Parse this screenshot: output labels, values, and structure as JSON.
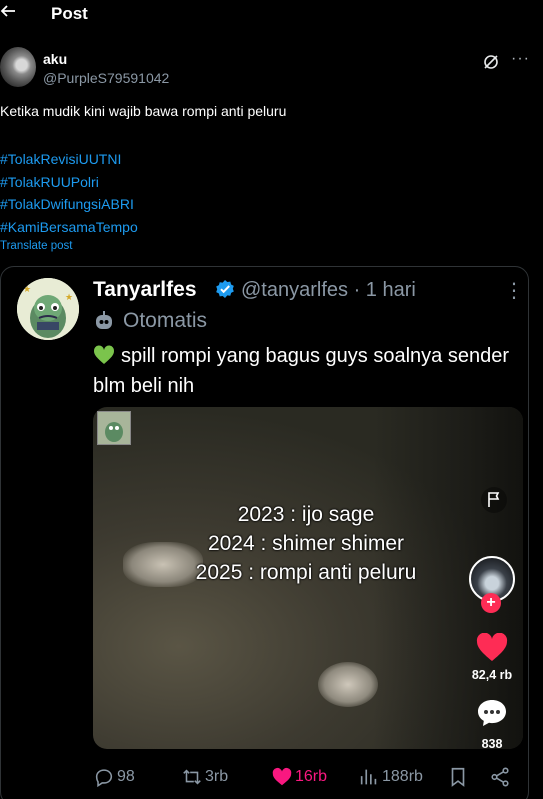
{
  "header": {
    "back_icon": "arrow-left-icon",
    "title": "Post"
  },
  "post": {
    "author_name": "aku",
    "author_handle": "@PurpleS79591042",
    "text": "Ketika mudik kini wajib bawa rompi anti peluru",
    "hashtags": [
      "#TolakRevisiUUTNI",
      "#TolakRUUPolri",
      "#TolakDwifungsiABRI",
      "#KamiBersamaTempo"
    ],
    "translate_label": "Translate post",
    "more_label": "···"
  },
  "quote": {
    "name": "Tanyarlfes",
    "handle": "@tanyarlfes · 1 hari",
    "more_label": "⋮",
    "automated_label": "Otomatis",
    "text": "spill rompi yang bagus guys soalnya sender blm beli nih",
    "media": {
      "overlay_lines": [
        "2023 : ijo sage",
        "2024 : shimer shimer",
        "2025 : rompi anti peluru"
      ],
      "likes": "82,4 rb",
      "comments": "838",
      "follow_plus": "+"
    }
  },
  "actions": {
    "replies": "98",
    "reposts": "3rb",
    "likes": "16rb",
    "views": "188rb"
  },
  "colors": {
    "accent": "#1d9bf0",
    "like": "#f91880",
    "muted": "#8b98a5",
    "tiktok_red": "#fe2c55"
  }
}
